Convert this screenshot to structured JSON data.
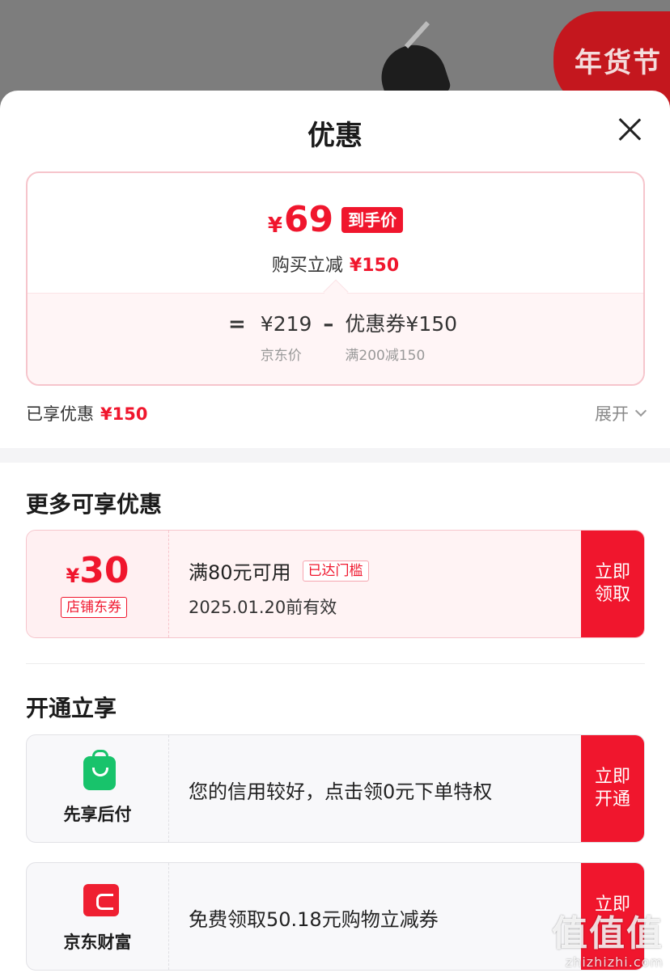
{
  "backdrop": {
    "festival_badge": "年货节"
  },
  "sheet": {
    "title": "优惠",
    "close_icon": "close-icon"
  },
  "price_card": {
    "final_currency": "¥",
    "final_amount": "69",
    "final_tag": "到手价",
    "reduce_label": "购买立减",
    "reduce_amount": "¥150",
    "equals": "=",
    "jd_price": "¥219",
    "jd_price_label": "京东价",
    "minus": "–",
    "coupon_value": "优惠券¥150",
    "coupon_rule": "满200减150"
  },
  "enjoyed": {
    "label": "已享优惠",
    "amount": "¥150",
    "expand_label": "展开",
    "expand_icon": "chevron-down-icon"
  },
  "more_offers": {
    "title": "更多可享优惠",
    "coupon": {
      "currency": "¥",
      "amount": "30",
      "type": "店铺东券",
      "condition": "满80元可用",
      "badge": "已达门槛",
      "expiry": "2025.01.20前有效",
      "cta": "立即领取"
    }
  },
  "activate": {
    "title": "开通立享",
    "services": [
      {
        "name": "先享后付",
        "icon": "shopping-bag-icon",
        "text": "您的信用较好，点击领0元下单特权",
        "cta": "立即开通"
      },
      {
        "name": "京东财富",
        "icon": "wallet-icon",
        "text": "免费领取50.18元购物立减券",
        "cta": "立即"
      }
    ]
  },
  "watermark": {
    "logo": "值值值",
    "url": "zhizhizhi.com"
  },
  "colors": {
    "accent": "#f0162d",
    "coupon_border": "#f6c5cc",
    "green": "#18c36b"
  }
}
